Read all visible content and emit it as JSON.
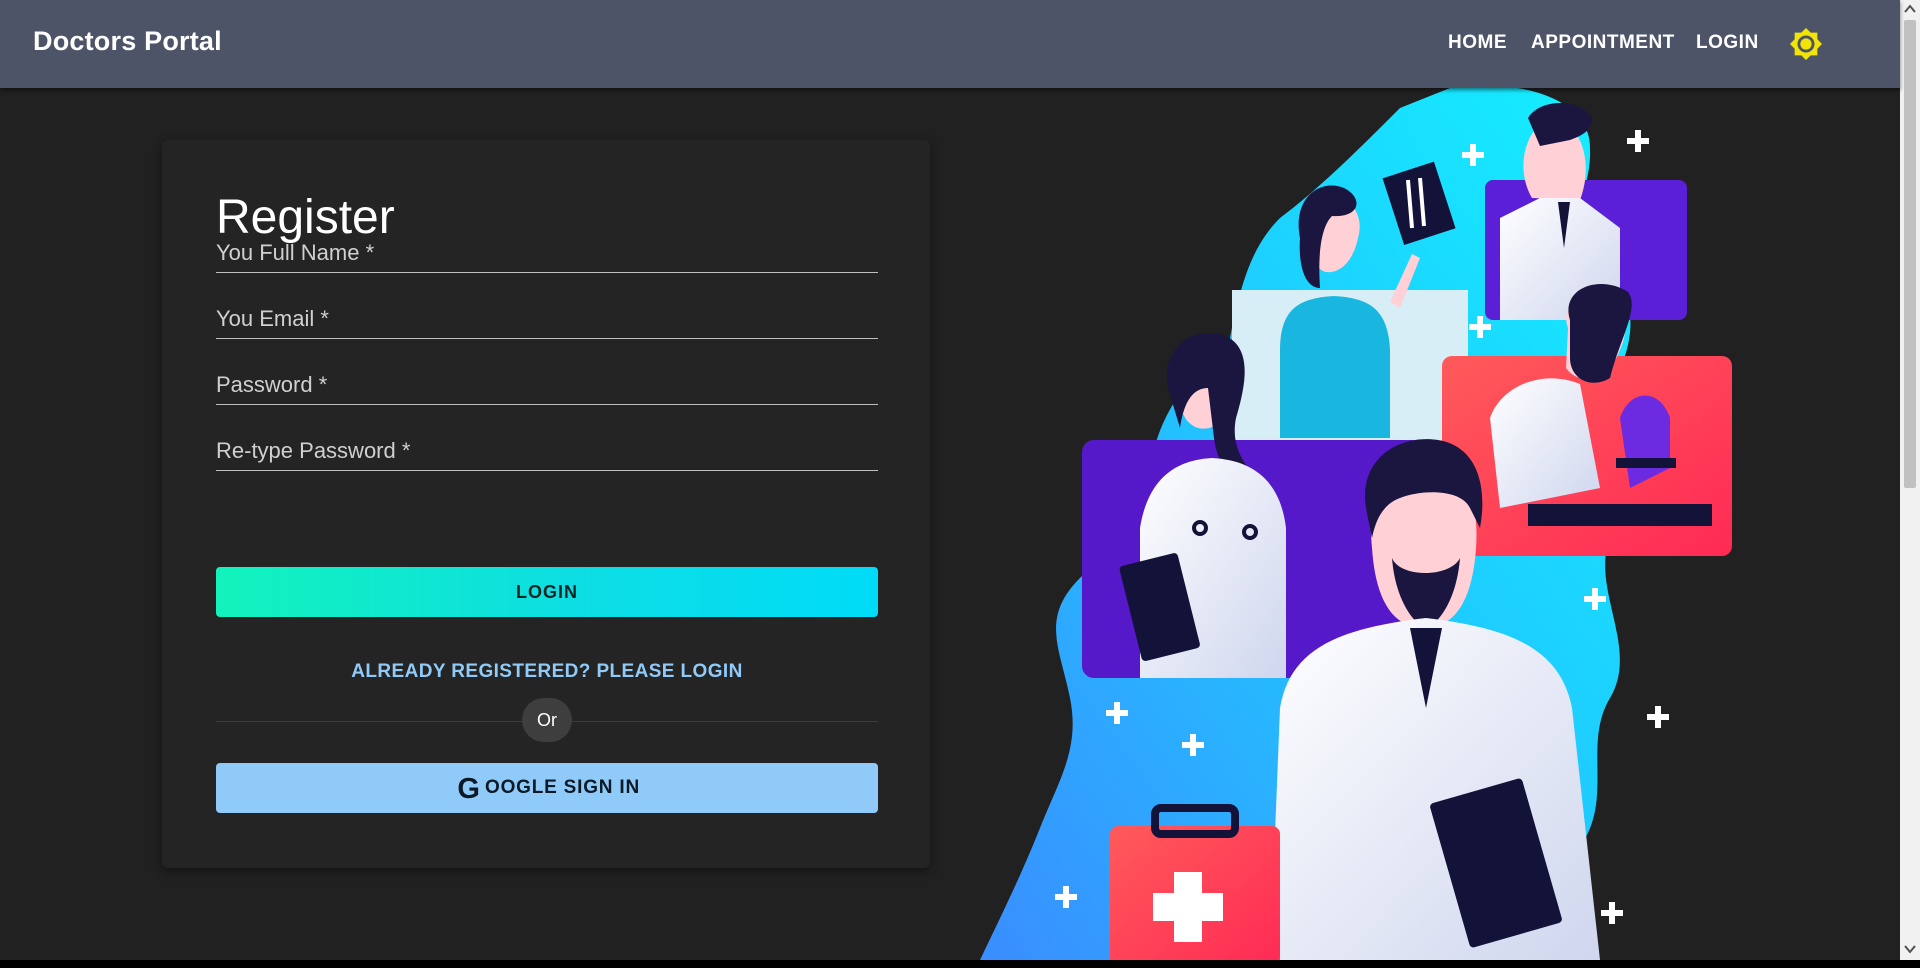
{
  "header": {
    "brand": "Doctors Portal",
    "nav": [
      "HOME",
      "APPOINTMENT",
      "LOGIN"
    ],
    "theme_icon": "sun-icon",
    "theme_icon_color": "#f2e406"
  },
  "register": {
    "title": "Register",
    "fields": [
      {
        "label": "You Full Name *",
        "value": ""
      },
      {
        "label": "You Email *",
        "value": ""
      },
      {
        "label": "Password *",
        "value": ""
      },
      {
        "label": "Re-type Password *",
        "value": ""
      }
    ],
    "submit_label": "LOGIN",
    "already_link": "ALREADY REGISTERED? PLEASE LOGIN",
    "divider_text": "Or",
    "google_prefix": "G",
    "google_label": "OOGLE SIGN IN",
    "google_icon": "google-icon"
  },
  "colors": {
    "appbar": "#4d5468",
    "background": "#212121",
    "accent_gradient_start": "#12f3bc",
    "accent_gradient_end": "#00dcf8",
    "link": "#90caf9",
    "google_button": "#90caf9"
  },
  "illustration": {
    "icon": "doctors-illustration"
  }
}
